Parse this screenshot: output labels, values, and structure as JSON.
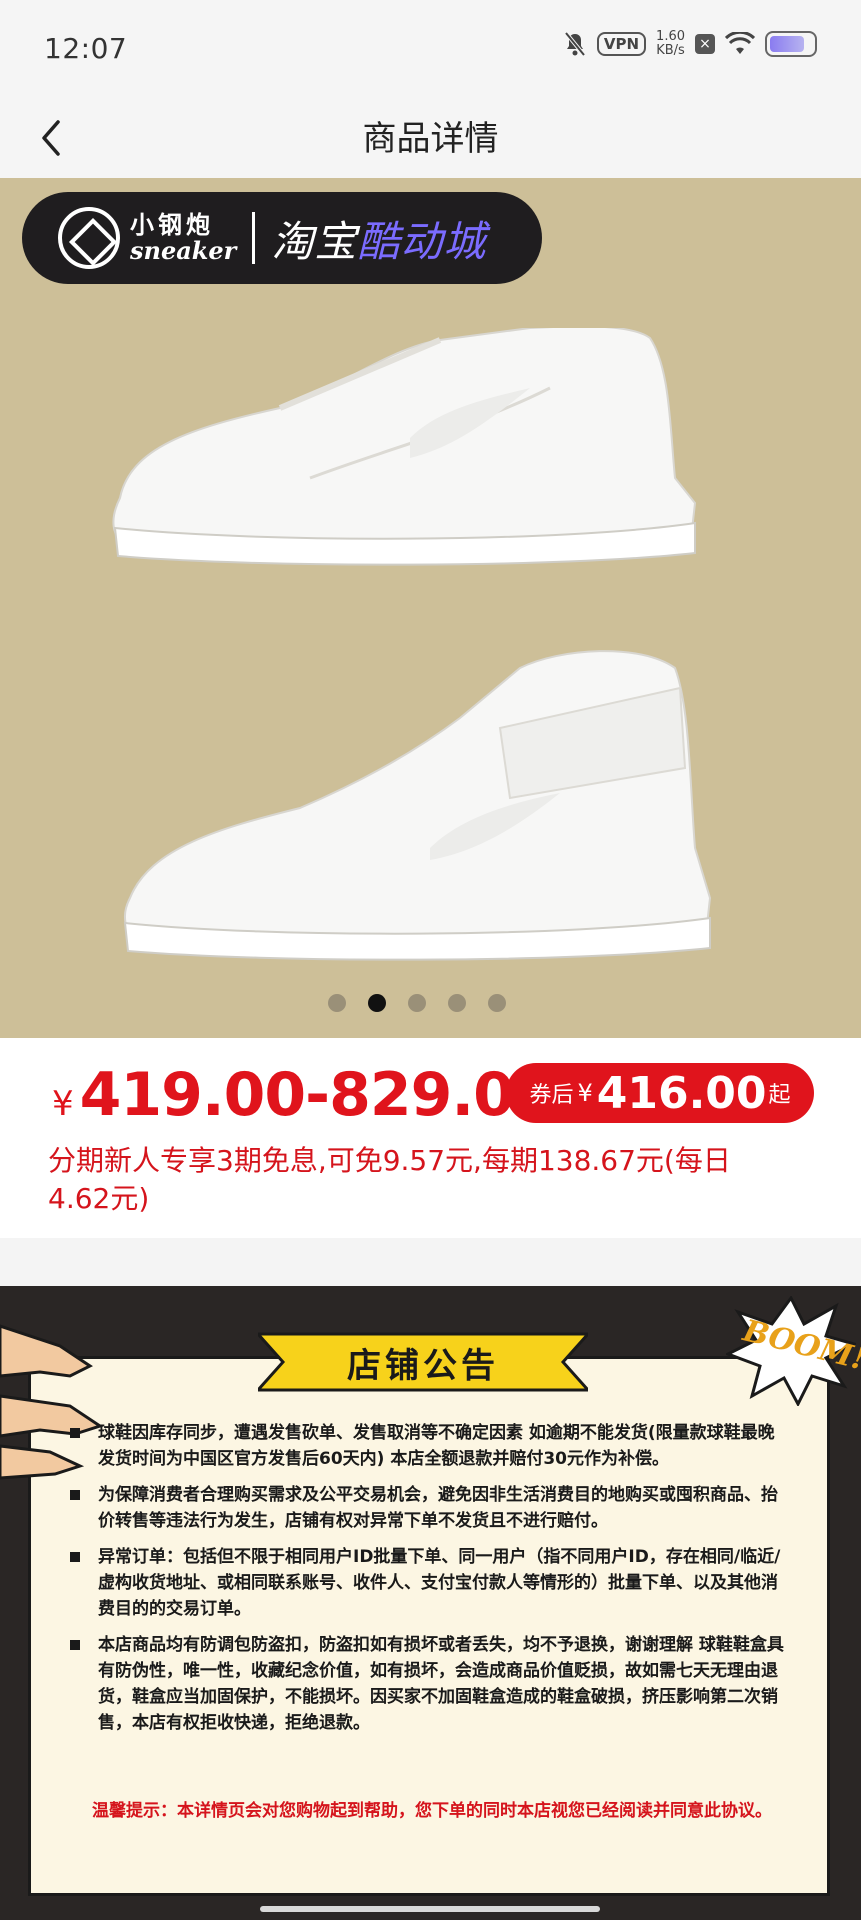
{
  "status_bar": {
    "time": "12:07",
    "vpn": "VPN",
    "speed_value": "1.60",
    "speed_unit": "KB/s"
  },
  "nav": {
    "title": "商品详情"
  },
  "gallery": {
    "banner_brand_cn": "小钢炮",
    "banner_brand_en": "sneaker",
    "banner_shop_prefix": "淘宝",
    "banner_shop_highlight": "酷动城",
    "dots_count": 5,
    "active_index": 1
  },
  "price": {
    "currency": "¥",
    "range": "419.00-829.00",
    "coupon_label": "券后",
    "coupon_currency": "¥",
    "coupon_value": "416.00",
    "coupon_suffix": "起",
    "installment_text": "分期新人专享3期免息,可免9.57元,每期138.67元(每日4.62元)"
  },
  "notice": {
    "title": "店铺公告",
    "boom": "BOOM!",
    "items": [
      "球鞋因库存同步，遭遇发售砍单、发售取消等不确定因素 如逾期不能发货(限量款球鞋最晚发货时间为中国区官方发售后60天内) 本店全额退款并赔付30元作为补偿。",
      "为保障消费者合理购买需求及公平交易机会，避免因非生活消费目的地购买或囤积商品、抬价转售等违法行为发生，店铺有权对异常下单不发货且不进行赔付。",
      "异常订单：包括但不限于相同用户ID批量下单、同一用户（指不同用户ID，存在相同/临近/虚构收货地址、或相同联系账号、收件人、支付宝付款人等情形的）批量下单、以及其他消费目的的交易订单。",
      "本店商品均有防调包防盗扣，防盗扣如有损坏或者丢失，均不予退换，谢谢理解 球鞋鞋盒具有防伪性，唯一性，收藏纪念价值，如有损坏，会造成商品价值贬损，故如需七天无理由退货，鞋盒应当加固保护，不能损坏。因买家不加固鞋盒造成的鞋盒破损，挤压影响第二次销售，本店有权拒收快递，拒绝退款。"
    ],
    "warm_tip": "温馨提示：本详情页会对您购物起到帮助，您下单的同时本店视您已经阅读并同意此协议。"
  }
}
